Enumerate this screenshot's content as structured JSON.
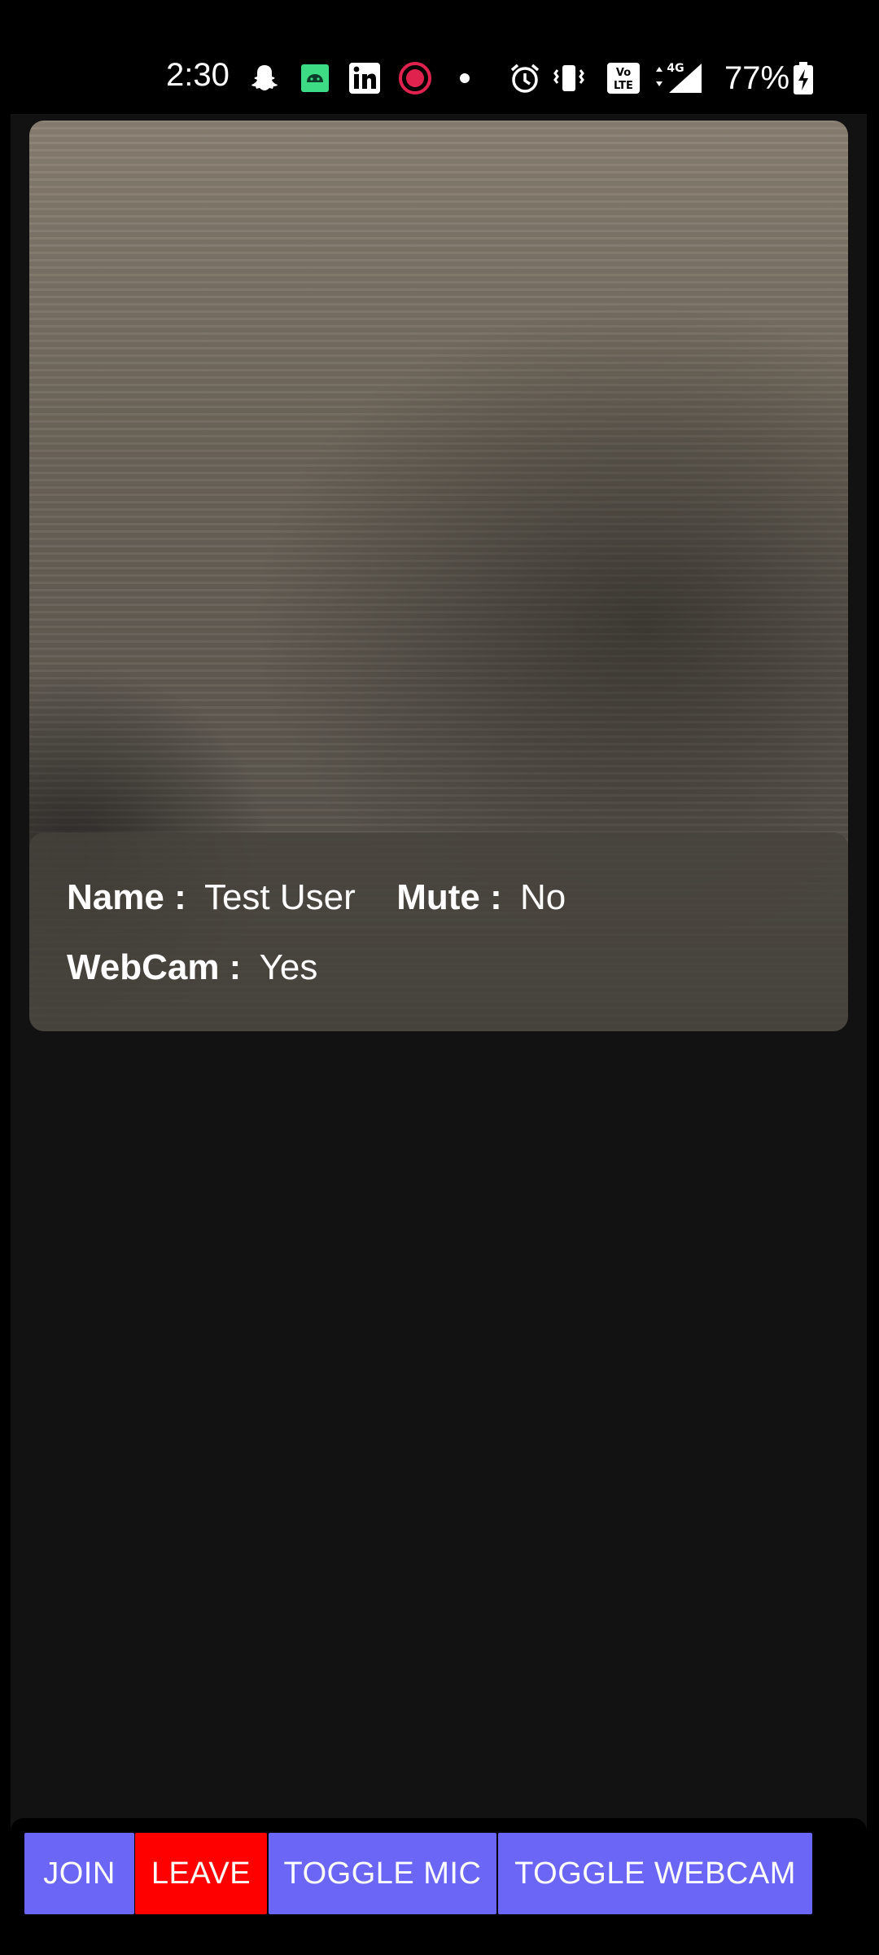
{
  "status_bar": {
    "time": "2:30",
    "battery": "77%",
    "icons": [
      "snapchat-icon",
      "android-icon",
      "linkedin-icon",
      "screen-record-icon",
      "dot-icon",
      "alarm-icon",
      "vibrate-icon",
      "volte-icon",
      "signal-4g-icon",
      "battery-charging-icon"
    ],
    "network_label": "4G"
  },
  "participant": {
    "name_label": "Name :",
    "name_value": "Test User",
    "mute_label": "Mute :",
    "mute_value": "No",
    "webcam_label": "WebCam :",
    "webcam_value": "Yes"
  },
  "toolbar": {
    "join_label": "JOIN",
    "leave_label": "LEAVE",
    "toggle_mic_label": "TOGGLE MIC",
    "toggle_webcam_label": "TOGGLE WEBCAM"
  },
  "colors": {
    "primary_button": "#6b66f5",
    "leave_button": "#ff0000",
    "background": "#121212"
  }
}
